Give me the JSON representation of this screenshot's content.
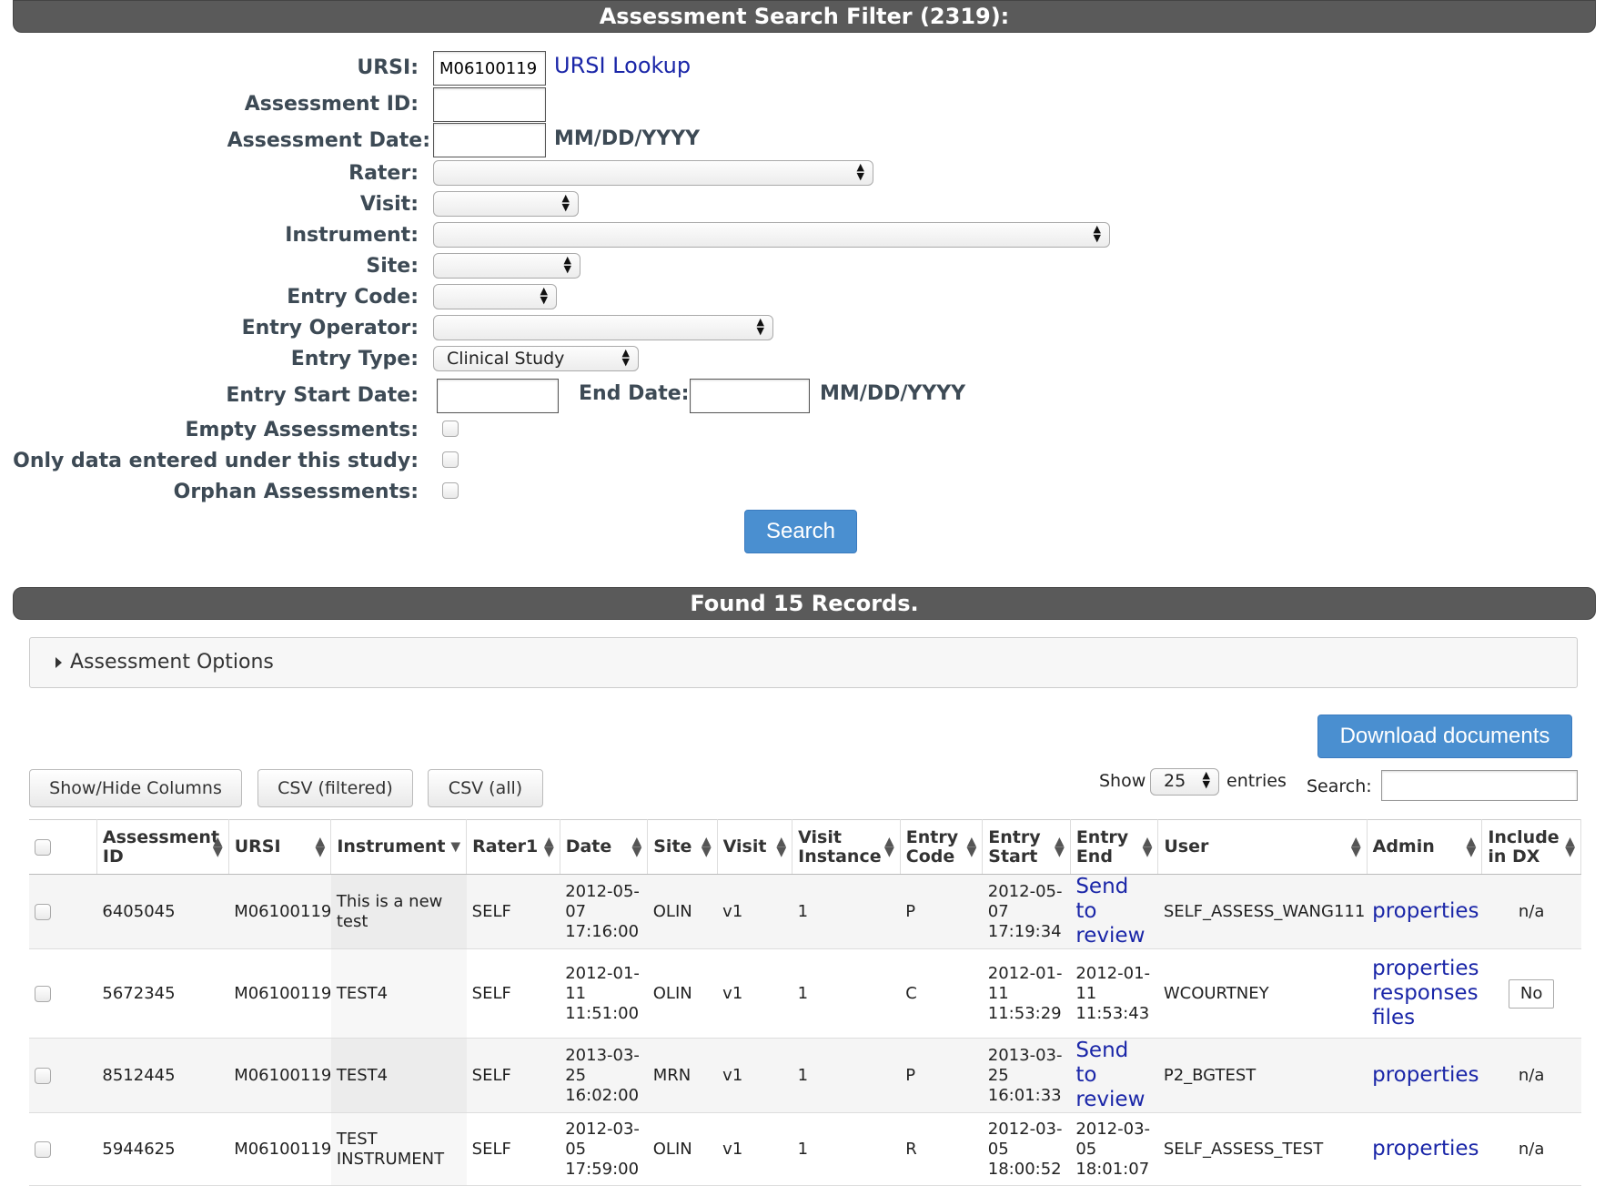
{
  "filter": {
    "title": "Assessment Search Filter (2319):",
    "labels": {
      "ursi": "URSI:",
      "assessment_id": "Assessment ID:",
      "assessment_date": "Assessment Date:",
      "rater": "Rater:",
      "visit": "Visit:",
      "instrument": "Instrument:",
      "site": "Site:",
      "entry_code": "Entry Code:",
      "entry_operator": "Entry Operator:",
      "entry_type": "Entry Type:",
      "entry_start_date": "Entry Start Date:",
      "end_date": "End Date:",
      "empty_assessments": "Empty Assessments:",
      "only_this_study": "Only data entered under this study:",
      "orphan_assessments": "Orphan Assessments:"
    },
    "values": {
      "ursi": "M06100119",
      "assessment_id": "",
      "assessment_date": "",
      "rater": "",
      "visit": "",
      "instrument": "",
      "site": "",
      "entry_code": "",
      "entry_operator": "",
      "entry_type": "Clinical Study",
      "entry_start_date": "",
      "end_date": ""
    },
    "ursi_lookup": "URSI Lookup",
    "date_hint": "MM/DD/YYYY",
    "search_button": "Search"
  },
  "results": {
    "title": "Found 15 Records.",
    "options_panel": "Assessment Options",
    "download_button": "Download documents",
    "buttons": {
      "show_hide": "Show/Hide Columns",
      "csv_filtered": "CSV (filtered)",
      "csv_all": "CSV (all)"
    },
    "show_label": "Show",
    "page_size": "25",
    "entries_label": "entries",
    "search_label": "Search:",
    "search_value": ""
  },
  "table": {
    "columns": [
      "Assessment ID",
      "URSI",
      "Instrument",
      "Rater1",
      "Date",
      "Site",
      "Visit",
      "Visit Instance",
      "Entry Code",
      "Entry Start",
      "Entry End",
      "User",
      "Admin",
      "Include in DX"
    ],
    "rows": [
      {
        "assessment_id": "6405045",
        "ursi": "M06100119",
        "instrument": "This is a new test",
        "rater1": "SELF",
        "date": "2012-05-07 17:16:00",
        "site": "OLIN",
        "visit": "v1",
        "visit_instance": "1",
        "entry_code": "P",
        "entry_start": "2012-05-07 17:19:34",
        "entry_end": "Send to review",
        "entry_end_is_link": true,
        "user": "SELF_ASSESS_WANG111",
        "admin": [
          "properties"
        ],
        "include_dx": "n/a"
      },
      {
        "assessment_id": "5672345",
        "ursi": "M06100119",
        "instrument": "TEST4",
        "rater1": "SELF",
        "date": "2012-01-11 11:51:00",
        "site": "OLIN",
        "visit": "v1",
        "visit_instance": "1",
        "entry_code": "C",
        "entry_start": "2012-01-11 11:53:29",
        "entry_end": "2012-01-11 11:53:43",
        "entry_end_is_link": false,
        "user": "WCOURTNEY",
        "admin": [
          "properties",
          "responses",
          "files"
        ],
        "include_dx": "No"
      },
      {
        "assessment_id": "8512445",
        "ursi": "M06100119",
        "instrument": "TEST4",
        "rater1": "SELF",
        "date": "2013-03-25 16:02:00",
        "site": "MRN",
        "visit": "v1",
        "visit_instance": "1",
        "entry_code": "P",
        "entry_start": "2013-03-25 16:01:33",
        "entry_end": "Send to review",
        "entry_end_is_link": true,
        "user": "P2_BGTEST",
        "admin": [
          "properties"
        ],
        "include_dx": "n/a"
      },
      {
        "assessment_id": "5944625",
        "ursi": "M06100119",
        "instrument": "TEST INSTRUMENT",
        "rater1": "SELF",
        "date": "2012-03-05 17:59:00",
        "site": "OLIN",
        "visit": "v1",
        "visit_instance": "1",
        "entry_code": "R",
        "entry_start": "2012-03-05 18:00:52",
        "entry_end": "2012-03-05 18:01:07",
        "entry_end_is_link": false,
        "user": "SELF_ASSESS_TEST",
        "admin": [
          "properties"
        ],
        "include_dx": "n/a"
      }
    ]
  },
  "colors": {
    "header_bar": "#5a5a5a",
    "link": "#1a26a8",
    "primary_button": "#4a8fd0",
    "label": "#3d4a55"
  }
}
